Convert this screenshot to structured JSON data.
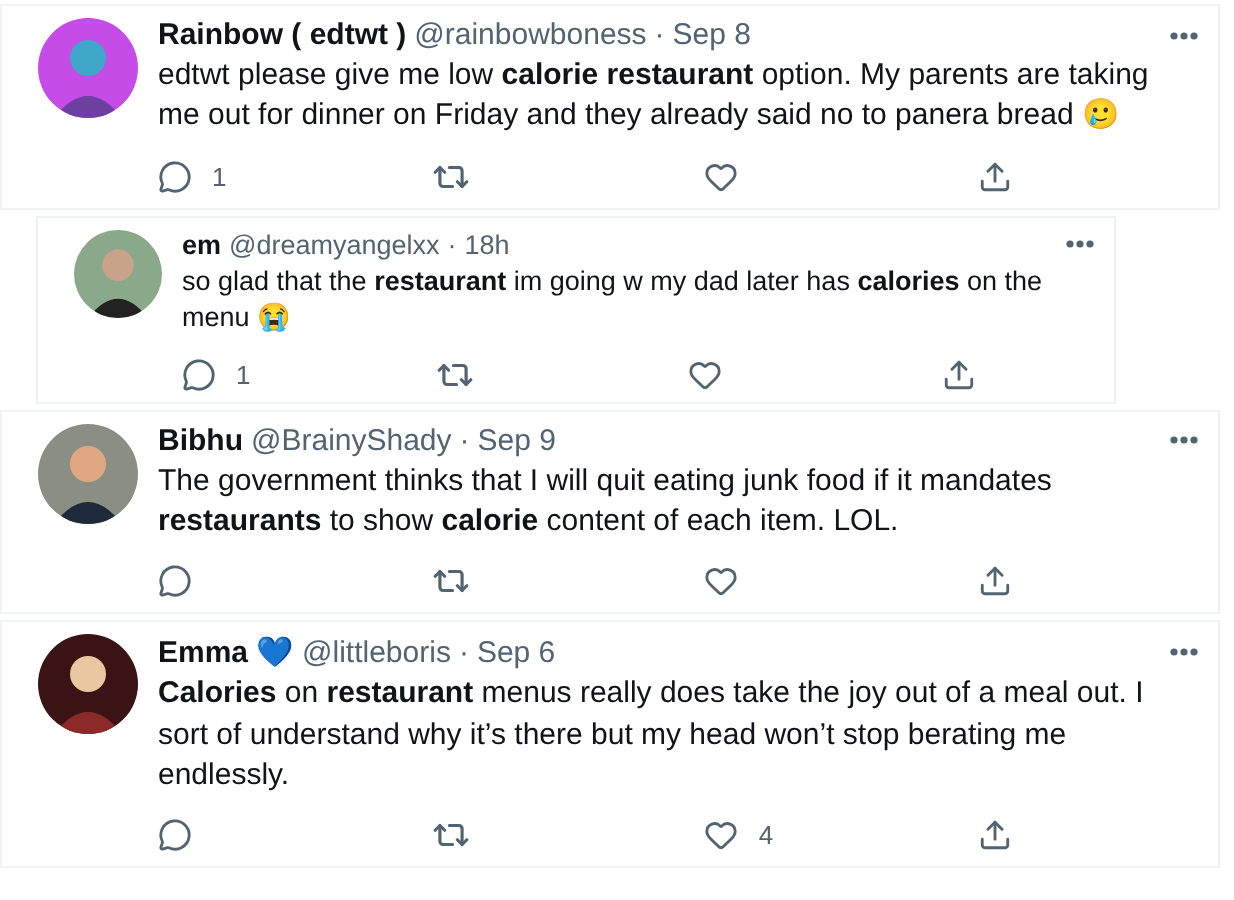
{
  "tweets": [
    {
      "kind": "post",
      "name": "Rainbow ( edtwt )",
      "handle": "@rainbowboness",
      "separator": "·",
      "time": "Sep 8",
      "text": "edtwt please give me low **calorie restaurant** option. My parents are taking me out for dinner on Friday and they already said no to panera bread  🥲",
      "replies": "1"
    },
    {
      "kind": "reply",
      "name": "em",
      "handle": "@dreamyangelxx",
      "separator": "·",
      "time": "18h",
      "text": "so glad that the **restaurant** im going w my dad later has **calories** on the menu 😭",
      "replies": "1"
    },
    {
      "kind": "post",
      "name": "Bibhu",
      "handle": "@BrainyShady",
      "separator": "·",
      "time": "Sep 9",
      "text": "The government thinks that I will quit eating junk food if it mandates **restaurants** to show **calorie** content of each item. LOL."
    },
    {
      "kind": "post",
      "name": "Emma",
      "name_emoji": "💙",
      "handle": "@littleboris",
      "separator": "·",
      "time": "Sep 6",
      "text": "**Calories** on **restaurant** menus really does take the joy out of a meal out. I sort of understand why it’s there but my head won’t stop berating me endlessly.",
      "likes": "4"
    }
  ]
}
